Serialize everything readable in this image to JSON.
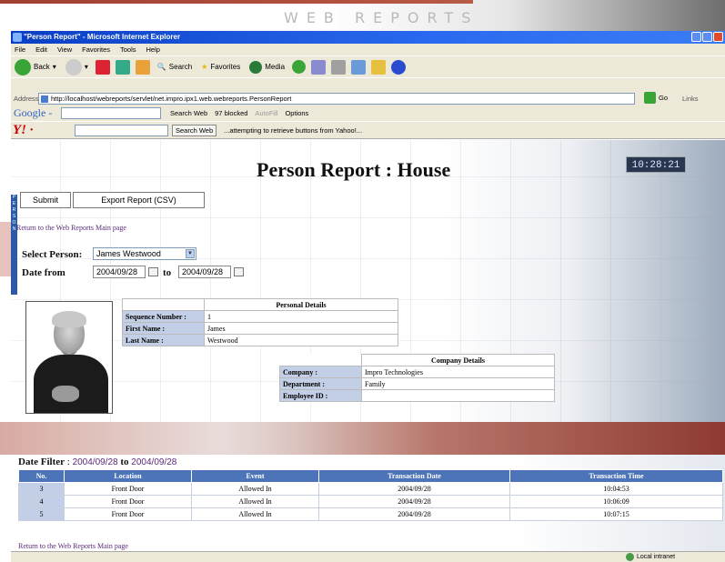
{
  "brand": "WEB REPORTS",
  "window": {
    "title": "\"Person Report\" - Microsoft Internet Explorer"
  },
  "menu": [
    "File",
    "Edit",
    "View",
    "Favorites",
    "Tools",
    "Help"
  ],
  "toolbar": {
    "back": "Back",
    "search": "Search",
    "favorites": "Favorites",
    "media": "Media"
  },
  "address": {
    "label": "Address",
    "url": "http://localhost/webreports/servlet/net.impro.ipx1.web.webreports.PersonReport",
    "go": "Go",
    "links": "Links"
  },
  "google": {
    "logo": "Google -",
    "search_web": "Search Web",
    "blocked": "97 blocked",
    "autofill": "AutoFill",
    "options": "Options"
  },
  "yahoo": {
    "logo": "Y! · ",
    "search_web": "Search Web",
    "status": "...attempting to retrieve buttons from Yahoo!..."
  },
  "report": {
    "title": "Person Report : House",
    "clock": "10:28:21",
    "submit": "Submit",
    "export": "Export Report (CSV)",
    "return_link": "Return to the Web Reports Main page",
    "select_person_label": "Select Person:",
    "selected_person": "James Westwood",
    "date_from_label": "Date from",
    "date_from": "2004/09/28",
    "to_label": "to",
    "date_to": "2004/09/28"
  },
  "personal": {
    "header": "Personal Details",
    "rows": [
      {
        "label": "Sequence Number :",
        "value": "1"
      },
      {
        "label": "First Name :",
        "value": "James"
      },
      {
        "label": "Last Name :",
        "value": "Westwood"
      }
    ]
  },
  "company": {
    "header": "Company Details",
    "rows": [
      {
        "label": "Company :",
        "value": "Impro Technologies"
      },
      {
        "label": "Department :",
        "value": "Family"
      },
      {
        "label": "Employee ID :",
        "value": ""
      }
    ]
  },
  "transactions": {
    "filter_label": "Date Filter",
    "filter_from": "2004/09/28",
    "filter_to_label": "to",
    "filter_to": "2004/09/28",
    "columns": [
      "No.",
      "Location",
      "Event",
      "Transaction Date",
      "Transaction Time"
    ],
    "rows": [
      {
        "no": "3",
        "location": "Front Door",
        "event": "Allowed In",
        "date": "2004/09/28",
        "time": "10:04:53"
      },
      {
        "no": "4",
        "location": "Front Door",
        "event": "Allowed In",
        "date": "2004/09/28",
        "time": "10:06:09"
      },
      {
        "no": "5",
        "location": "Front Door",
        "event": "Allowed In",
        "date": "2004/09/28",
        "time": "10:07:15"
      }
    ],
    "return_link": "Return to the Web Reports Main page"
  },
  "status": {
    "zone": "Local intranet"
  }
}
